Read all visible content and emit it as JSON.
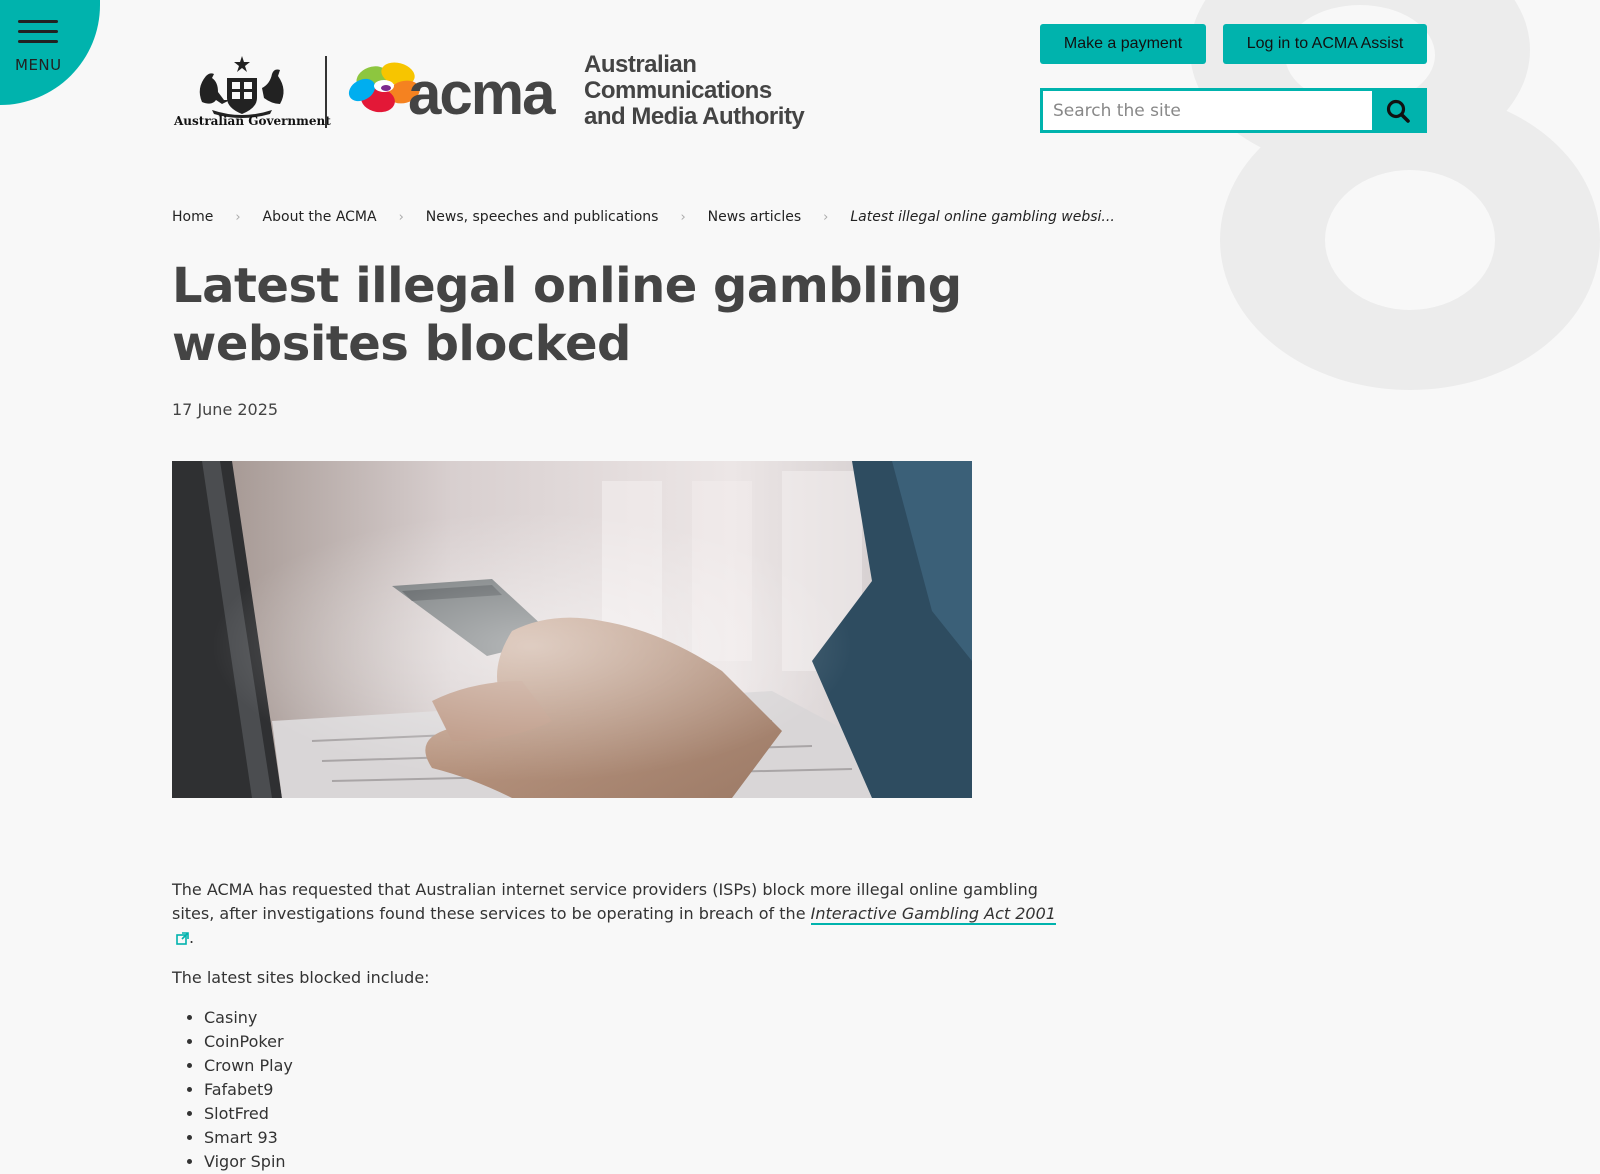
{
  "menu": {
    "label": "MENU"
  },
  "logo": {
    "gov_text": "Australian Government",
    "acma_word": "acma",
    "full_name": [
      "Australian",
      "Communications",
      "and Media Authority"
    ]
  },
  "header": {
    "pay_label": "Make a payment",
    "login_label": "Log in to ACMA Assist",
    "search_placeholder": "Search the site"
  },
  "breadcrumb": [
    "Home",
    "About the ACMA",
    "News, speeches and publications",
    "News articles",
    "Latest illegal online gambling websi..."
  ],
  "article": {
    "title_line1": "Latest illegal online gambling",
    "title_line2": "websites blocked",
    "date": "17 June 2025",
    "intro_before_link": "The ACMA has requested that Australian internet service providers (ISPs) block more illegal online gambling sites, after investigations found these services to be operating in breach of the ",
    "act_link": "Interactive Gambling Act 2001",
    "intro_after_link": ".",
    "list_intro": "The latest sites blocked include:",
    "sites": [
      "Casiny",
      "CoinPoker",
      "Crown Play",
      "Fafabet9",
      "SlotFred",
      "Smart 93",
      "Vigor Spin"
    ]
  },
  "colors": {
    "accent": "#00b3ad",
    "heading": "#444444",
    "background": "#f8f8f8"
  },
  "icons": {
    "menu": "hamburger-icon",
    "search": "search-icon",
    "external": "external-link-icon"
  }
}
